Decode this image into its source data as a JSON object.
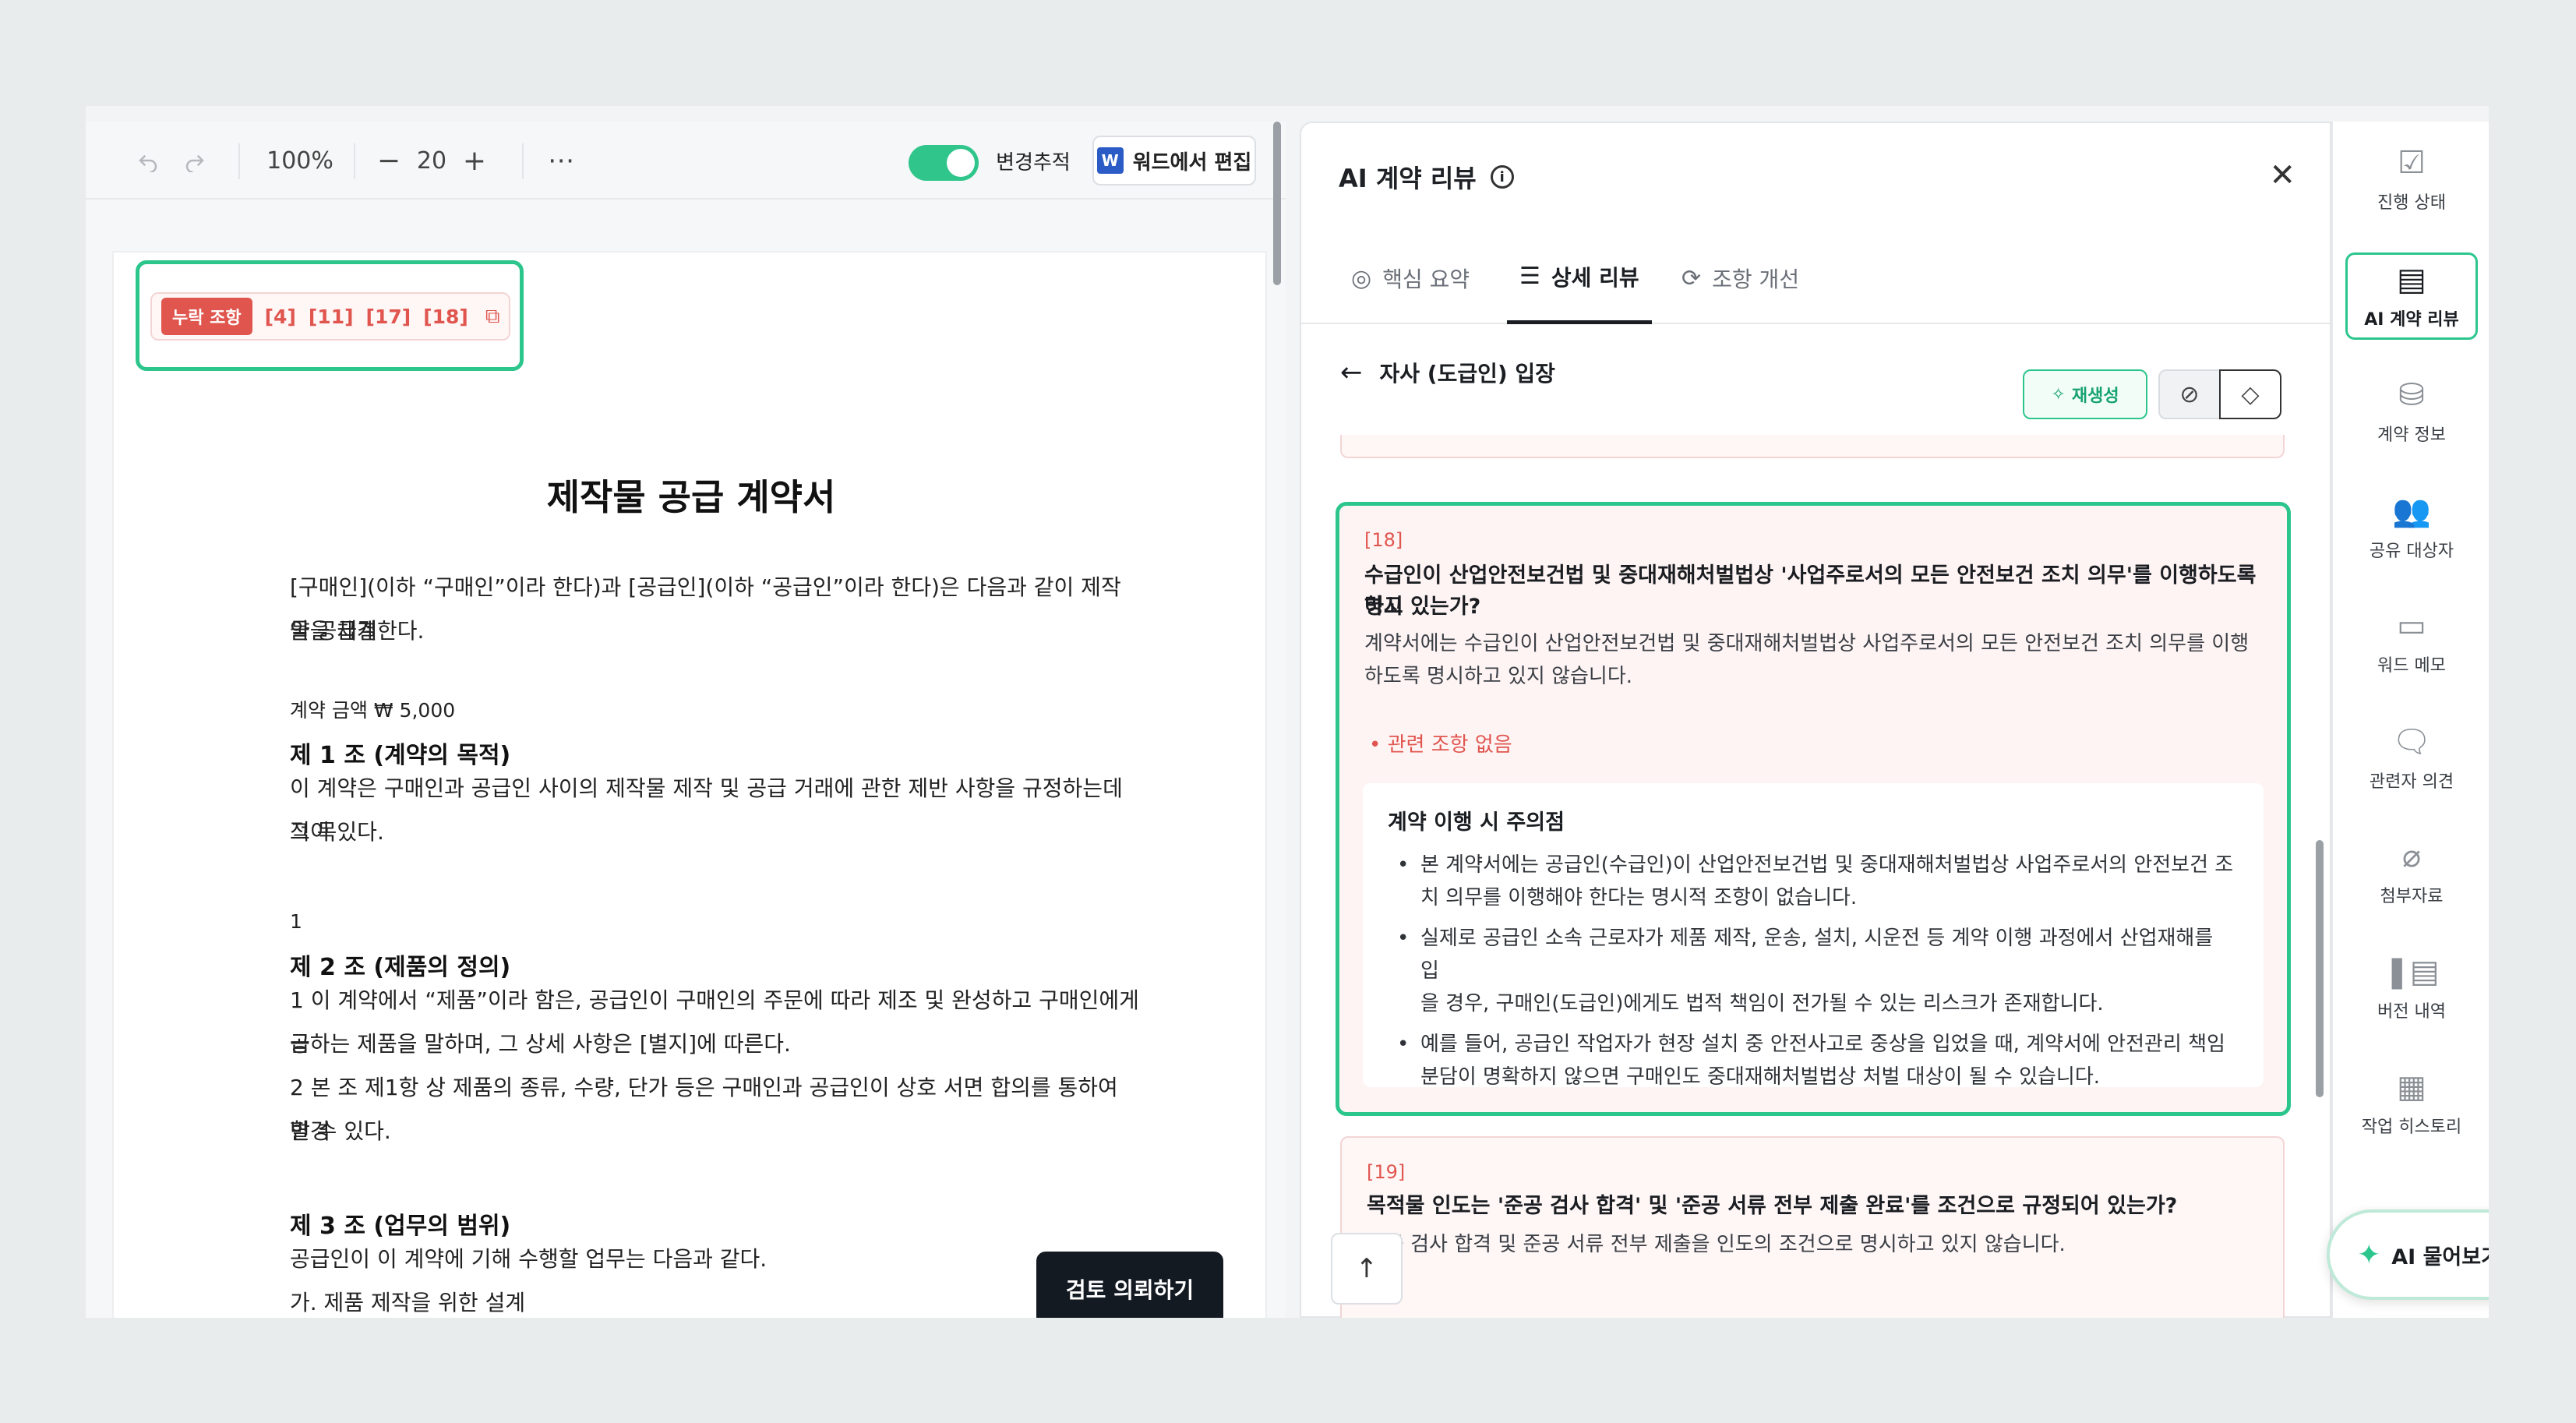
{
  "toolbar": {
    "zoom": "100%",
    "font_size": "20",
    "track_changes_label": "변경추적",
    "word_edit_label": "워드에서 편집",
    "word_icon_text": "W"
  },
  "missing": {
    "badge": "누락 조항",
    "refs": [
      "[4]",
      "[11]",
      "[17]",
      "[18]"
    ]
  },
  "document": {
    "title": "제작물 공급 계약서",
    "intro_line1": "[구매인](이하 “구매인”이라 한다)과 [공급인](이하 “공급인”이라 한다)은 다음과 같이 제작물 공급계",
    "intro_line2": "약을 체결한다.",
    "amount": "계약 금액 ₩ 5,000",
    "art1_title": "제 1 조 (계약의 목적)",
    "art1_line1": "이 계약은 구매인과 공급인 사이의 제작물 제작 및 공급 거래에 관한 제반 사항을 규정하는데 그 목",
    "art1_line2": "적이 있다.",
    "num1": "1",
    "art2_title": "제 2 조 (제품의 정의)",
    "art2_p1_line1": "1      이 계약에서 “제품”이라 함은, 공급인이 구매인의 주문에 따라 제조 및 완성하고 구매인에게 공",
    "art2_p1_line2": "급하는 제품을 말하며, 그 상세 사항은 [별지]에 따른다.",
    "art2_p2_line1": "2      본 조 제1항 상 제품의 종류, 수량, 단가 등은 구매인과 공급인이 상호 서면 합의를 통하여 변경",
    "art2_p2_line2": "할 수 있다.",
    "art3_title": "제 3 조 (업무의 범위)",
    "art3_line1": "공급인이 이 계약에 기해 수행할 업무는 다음과 같다.",
    "art3_line2": "가. 제품 제작을 위한 설계"
  },
  "review_request_label": "검토 의뢰하기",
  "panel": {
    "title": "AI 계약 리뷰",
    "tabs": [
      {
        "label": "핵심 요약",
        "icon": "summary-icon"
      },
      {
        "label": "상세 리뷰",
        "icon": "list-check-icon"
      },
      {
        "label": "조항 개선",
        "icon": "improve-icon"
      }
    ],
    "position_label": "자사 (도급인) 입장",
    "regen_label": "재생성",
    "card18": {
      "num": "[18]",
      "question_line1": "수급인이 산업안전보건법 및 중대재해처벌법상 '사업주로서의 모든 안전보건 조치 의무'를 이행하도록 명시",
      "question_line2": "하고 있는가?",
      "answer_line1": "계약서에는 수급인이 산업안전보건법 및 중대재해처벌법상 사업주로서의 모든 안전보건 조치 의무를 이행",
      "answer_line2": "하도록 명시하고 있지 않습니다.",
      "flag": "관련 조항 없음",
      "notice_title": "계약 이행 시 주의점",
      "notices": [
        {
          "line1": "본 계약서에는 공급인(수급인)이 산업안전보건법 및 중대재해처벌법상 사업주로서의 안전보건 조",
          "line2": "치 의무를 이행해야 한다는 명시적 조항이 없습니다."
        },
        {
          "line1": "실제로 공급인 소속 근로자가 제품 제작, 운송, 설치, 시운전 등 계약 이행 과정에서 산업재해를 입",
          "line2": "을 경우, 구매인(도급인)에게도 법적 책임이 전가될 수 있는 리스크가 존재합니다."
        },
        {
          "line1": "예를 들어, 공급인 작업자가 현장 설치 중 안전사고로 중상을 입었을 때, 계약서에 안전관리 책임",
          "line2": "분담이 명확하지 않으면 구매인도 중대재해처벌법상 처벌 대상이 될 수 있습니다."
        }
      ]
    },
    "card19": {
      "num": "[19]",
      "question": "목적물 인도는 '준공 검사 합격' 및 '준공 서류 전부 제출 완료'를 조건으로 규정되어 있는가?",
      "answer": "준공 검사 합격 및 준공 서류 전부 제출을 인도의 조건으로 명시하고 있지 않습니다."
    }
  },
  "sidebar": {
    "items": [
      {
        "label": "진행 상태",
        "icon": "progress-icon"
      },
      {
        "label": "AI 계약 리뷰",
        "icon": "ai-review-icon"
      },
      {
        "label": "계약 정보",
        "icon": "database-icon"
      },
      {
        "label": "공유 대상자",
        "icon": "people-icon"
      },
      {
        "label": "워드 메모",
        "icon": "memo-icon"
      },
      {
        "label": "관련자 의견",
        "icon": "lock-comment-icon"
      },
      {
        "label": "첨부자료",
        "icon": "paperclip-icon"
      },
      {
        "label": "버전 내역",
        "icon": "versions-icon"
      },
      {
        "label": "작업 히스토리",
        "icon": "history-icon"
      }
    ]
  },
  "ai_ask_label": "AI 물어보기",
  "colors": {
    "accent": "#2cc68d",
    "danger": "#e0564f",
    "dark_button": "#141a22"
  }
}
